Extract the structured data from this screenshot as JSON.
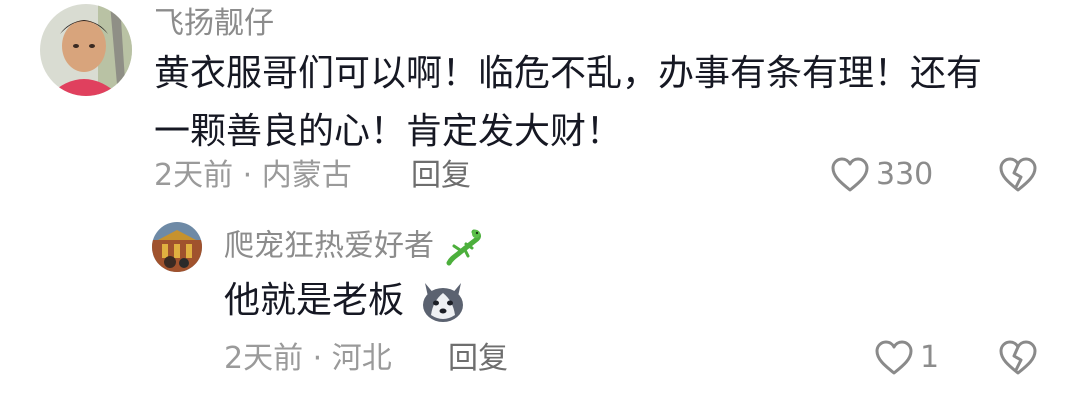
{
  "comment": {
    "username": "飞扬靓仔",
    "text_line1": "黄衣服哥们可以啊！临危不乱，办事有条有理！还有",
    "text_line2": "一颗善良的心！肯定发大财！",
    "time": "2天前",
    "separator": "·",
    "location": "内蒙古",
    "reply_label": "回复",
    "like_count": "330",
    "icons": [
      "heart-outline-icon",
      "broken-heart-icon"
    ]
  },
  "reply": {
    "username": "爬宠狂热爱好者",
    "username_emoji": "lizard-emoji",
    "text": "他就是老板",
    "text_emoji": "husky-dog-emoji",
    "time": "2天前",
    "separator": "·",
    "location": "河北",
    "reply_label": "回复",
    "like_count": "1",
    "icons": [
      "heart-outline-icon",
      "broken-heart-icon"
    ]
  },
  "colors": {
    "username": "#8c8c8c",
    "content": "#161823",
    "meta": "#9a9a9a",
    "icon": "#8a8a8a"
  }
}
